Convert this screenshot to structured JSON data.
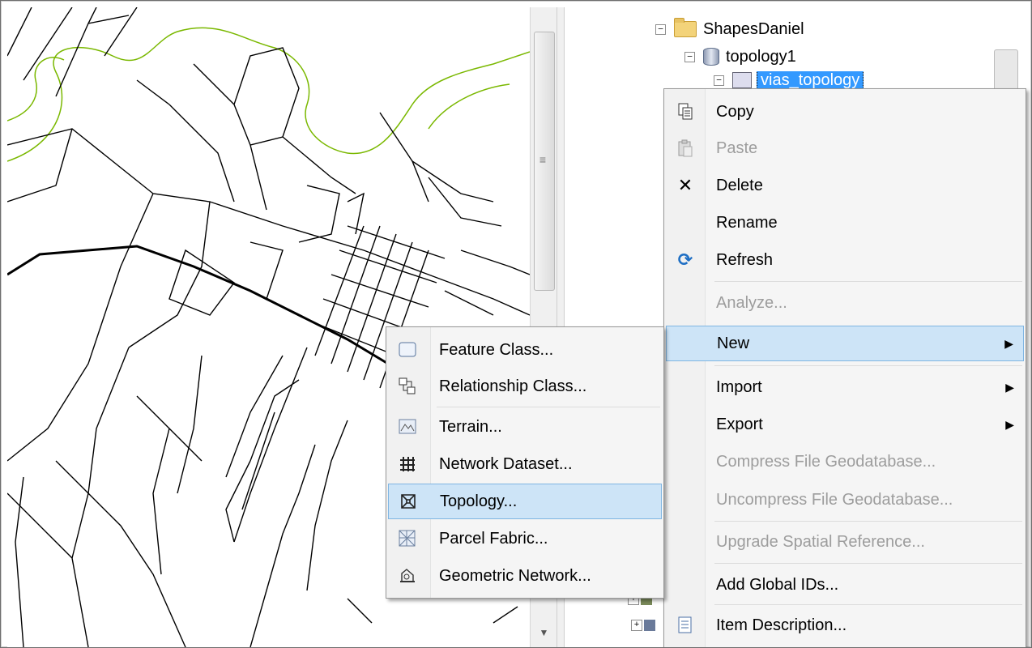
{
  "tree": {
    "items": [
      {
        "label": "ShapesDaniel",
        "expander": "−",
        "icon": "folder-icon"
      },
      {
        "label": "topology1",
        "expander": "−",
        "icon": "database-icon"
      },
      {
        "label": "vias_topology",
        "expander": "−",
        "icon": "feature-dataset-icon",
        "selected": true
      }
    ]
  },
  "context_menu": {
    "items": [
      {
        "label": "Copy",
        "icon": "copy-icon",
        "enabled": true
      },
      {
        "label": "Paste",
        "icon": "paste-icon",
        "enabled": false
      },
      {
        "label": "Delete",
        "icon": "delete-icon",
        "enabled": true
      },
      {
        "label": "Rename",
        "icon": "",
        "enabled": true
      },
      {
        "label": "Refresh",
        "icon": "refresh-icon",
        "enabled": true
      },
      {
        "label": "Analyze...",
        "icon": "",
        "enabled": false
      },
      {
        "label": "New",
        "icon": "",
        "enabled": true,
        "submenu": true,
        "highlighted": true
      },
      {
        "label": "Import",
        "icon": "",
        "enabled": true,
        "submenu": true
      },
      {
        "label": "Export",
        "icon": "",
        "enabled": true,
        "submenu": true
      },
      {
        "label": "Compress File Geodatabase...",
        "icon": "",
        "enabled": false
      },
      {
        "label": "Uncompress File Geodatabase...",
        "icon": "",
        "enabled": false
      },
      {
        "label": "Upgrade Spatial Reference...",
        "icon": "",
        "enabled": false
      },
      {
        "label": "Add Global IDs...",
        "icon": "",
        "enabled": true
      },
      {
        "label": "Item Description...",
        "icon": "item-description-icon",
        "enabled": true
      }
    ]
  },
  "new_submenu": {
    "items": [
      {
        "label": "Feature Class...",
        "icon": "feature-class-icon"
      },
      {
        "label": "Relationship Class...",
        "icon": "relationship-class-icon"
      },
      {
        "label": "Terrain...",
        "icon": "terrain-icon"
      },
      {
        "label": "Network Dataset...",
        "icon": "network-dataset-icon"
      },
      {
        "label": "Topology...",
        "icon": "topology-icon",
        "highlighted": true
      },
      {
        "label": "Parcel Fabric...",
        "icon": "parcel-fabric-icon"
      },
      {
        "label": "Geometric Network...",
        "icon": "geometric-network-icon"
      }
    ]
  },
  "colors": {
    "selection": "#3399ff",
    "highlight_bg": "#cde4f7",
    "highlight_border": "#7fb5e2",
    "contour_line": "#7ab800",
    "road_line": "#000000"
  }
}
